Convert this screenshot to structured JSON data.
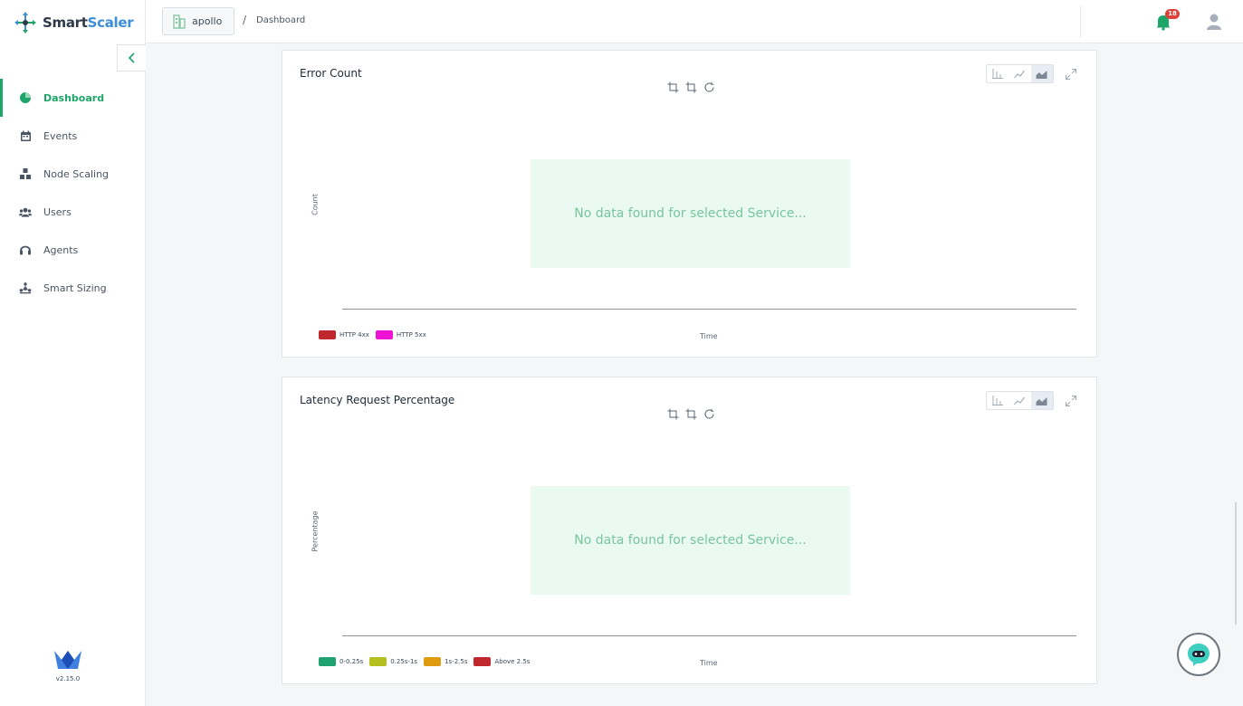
{
  "app": {
    "name_part1": "Smart",
    "name_part2": "Scaler",
    "version": "v2.15.0"
  },
  "sidebar": {
    "items": [
      {
        "label": "Dashboard",
        "icon": "pie-chart-icon",
        "active": true
      },
      {
        "label": "Events",
        "icon": "calendar-icon"
      },
      {
        "label": "Node Scaling",
        "icon": "cubes-icon"
      },
      {
        "label": "Users",
        "icon": "users-icon"
      },
      {
        "label": "Agents",
        "icon": "headset-icon"
      },
      {
        "label": "Smart Sizing",
        "icon": "network-icon"
      }
    ]
  },
  "header": {
    "project": "apollo",
    "separator": "/",
    "breadcrumb": "Dashboard",
    "notifications": "18"
  },
  "colors": {
    "accent": "#1ea568",
    "nodata_bg": "#eafaf2",
    "nodata_text": "#79c59d"
  },
  "cards": [
    {
      "title": "Error Count",
      "ylabel": "Count",
      "xlabel": "Time",
      "empty_message": "No data found for selected Service...",
      "legend": [
        {
          "label": "HTTP 4xx",
          "color": "#c0282d"
        },
        {
          "label": "HTTP 5xx",
          "color": "#ee12d4"
        }
      ]
    },
    {
      "title": "Latency Request Percentage",
      "ylabel": "Percentage",
      "xlabel": "Time",
      "empty_message": "No data found for selected Service...",
      "legend": [
        {
          "label": "0-0.25s",
          "color": "#1fa170"
        },
        {
          "label": "0.25s-1s",
          "color": "#b5c01e"
        },
        {
          "label": "1s-2.5s",
          "color": "#e09a0f"
        },
        {
          "label": "Above 2.5s",
          "color": "#c0282d"
        }
      ]
    }
  ]
}
